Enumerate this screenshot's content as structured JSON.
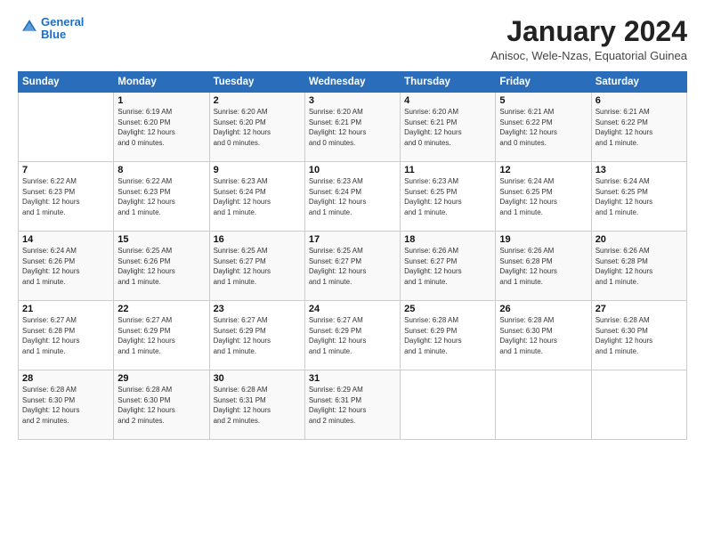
{
  "logo": {
    "line1": "General",
    "line2": "Blue"
  },
  "title": "January 2024",
  "subtitle": "Anisoc, Wele-Nzas, Equatorial Guinea",
  "days_of_week": [
    "Sunday",
    "Monday",
    "Tuesday",
    "Wednesday",
    "Thursday",
    "Friday",
    "Saturday"
  ],
  "weeks": [
    [
      {
        "day": "",
        "info": ""
      },
      {
        "day": "1",
        "info": "Sunrise: 6:19 AM\nSunset: 6:20 PM\nDaylight: 12 hours\nand 0 minutes."
      },
      {
        "day": "2",
        "info": "Sunrise: 6:20 AM\nSunset: 6:20 PM\nDaylight: 12 hours\nand 0 minutes."
      },
      {
        "day": "3",
        "info": "Sunrise: 6:20 AM\nSunset: 6:21 PM\nDaylight: 12 hours\nand 0 minutes."
      },
      {
        "day": "4",
        "info": "Sunrise: 6:20 AM\nSunset: 6:21 PM\nDaylight: 12 hours\nand 0 minutes."
      },
      {
        "day": "5",
        "info": "Sunrise: 6:21 AM\nSunset: 6:22 PM\nDaylight: 12 hours\nand 0 minutes."
      },
      {
        "day": "6",
        "info": "Sunrise: 6:21 AM\nSunset: 6:22 PM\nDaylight: 12 hours\nand 1 minute."
      }
    ],
    [
      {
        "day": "7",
        "info": "Sunrise: 6:22 AM\nSunset: 6:23 PM\nDaylight: 12 hours\nand 1 minute."
      },
      {
        "day": "8",
        "info": "Sunrise: 6:22 AM\nSunset: 6:23 PM\nDaylight: 12 hours\nand 1 minute."
      },
      {
        "day": "9",
        "info": "Sunrise: 6:23 AM\nSunset: 6:24 PM\nDaylight: 12 hours\nand 1 minute."
      },
      {
        "day": "10",
        "info": "Sunrise: 6:23 AM\nSunset: 6:24 PM\nDaylight: 12 hours\nand 1 minute."
      },
      {
        "day": "11",
        "info": "Sunrise: 6:23 AM\nSunset: 6:25 PM\nDaylight: 12 hours\nand 1 minute."
      },
      {
        "day": "12",
        "info": "Sunrise: 6:24 AM\nSunset: 6:25 PM\nDaylight: 12 hours\nand 1 minute."
      },
      {
        "day": "13",
        "info": "Sunrise: 6:24 AM\nSunset: 6:25 PM\nDaylight: 12 hours\nand 1 minute."
      }
    ],
    [
      {
        "day": "14",
        "info": "Sunrise: 6:24 AM\nSunset: 6:26 PM\nDaylight: 12 hours\nand 1 minute."
      },
      {
        "day": "15",
        "info": "Sunrise: 6:25 AM\nSunset: 6:26 PM\nDaylight: 12 hours\nand 1 minute."
      },
      {
        "day": "16",
        "info": "Sunrise: 6:25 AM\nSunset: 6:27 PM\nDaylight: 12 hours\nand 1 minute."
      },
      {
        "day": "17",
        "info": "Sunrise: 6:25 AM\nSunset: 6:27 PM\nDaylight: 12 hours\nand 1 minute."
      },
      {
        "day": "18",
        "info": "Sunrise: 6:26 AM\nSunset: 6:27 PM\nDaylight: 12 hours\nand 1 minute."
      },
      {
        "day": "19",
        "info": "Sunrise: 6:26 AM\nSunset: 6:28 PM\nDaylight: 12 hours\nand 1 minute."
      },
      {
        "day": "20",
        "info": "Sunrise: 6:26 AM\nSunset: 6:28 PM\nDaylight: 12 hours\nand 1 minute."
      }
    ],
    [
      {
        "day": "21",
        "info": "Sunrise: 6:27 AM\nSunset: 6:28 PM\nDaylight: 12 hours\nand 1 minute."
      },
      {
        "day": "22",
        "info": "Sunrise: 6:27 AM\nSunset: 6:29 PM\nDaylight: 12 hours\nand 1 minute."
      },
      {
        "day": "23",
        "info": "Sunrise: 6:27 AM\nSunset: 6:29 PM\nDaylight: 12 hours\nand 1 minute."
      },
      {
        "day": "24",
        "info": "Sunrise: 6:27 AM\nSunset: 6:29 PM\nDaylight: 12 hours\nand 1 minute."
      },
      {
        "day": "25",
        "info": "Sunrise: 6:28 AM\nSunset: 6:29 PM\nDaylight: 12 hours\nand 1 minute."
      },
      {
        "day": "26",
        "info": "Sunrise: 6:28 AM\nSunset: 6:30 PM\nDaylight: 12 hours\nand 1 minute."
      },
      {
        "day": "27",
        "info": "Sunrise: 6:28 AM\nSunset: 6:30 PM\nDaylight: 12 hours\nand 1 minute."
      }
    ],
    [
      {
        "day": "28",
        "info": "Sunrise: 6:28 AM\nSunset: 6:30 PM\nDaylight: 12 hours\nand 2 minutes."
      },
      {
        "day": "29",
        "info": "Sunrise: 6:28 AM\nSunset: 6:30 PM\nDaylight: 12 hours\nand 2 minutes."
      },
      {
        "day": "30",
        "info": "Sunrise: 6:28 AM\nSunset: 6:31 PM\nDaylight: 12 hours\nand 2 minutes."
      },
      {
        "day": "31",
        "info": "Sunrise: 6:29 AM\nSunset: 6:31 PM\nDaylight: 12 hours\nand 2 minutes."
      },
      {
        "day": "",
        "info": ""
      },
      {
        "day": "",
        "info": ""
      },
      {
        "day": "",
        "info": ""
      }
    ]
  ]
}
